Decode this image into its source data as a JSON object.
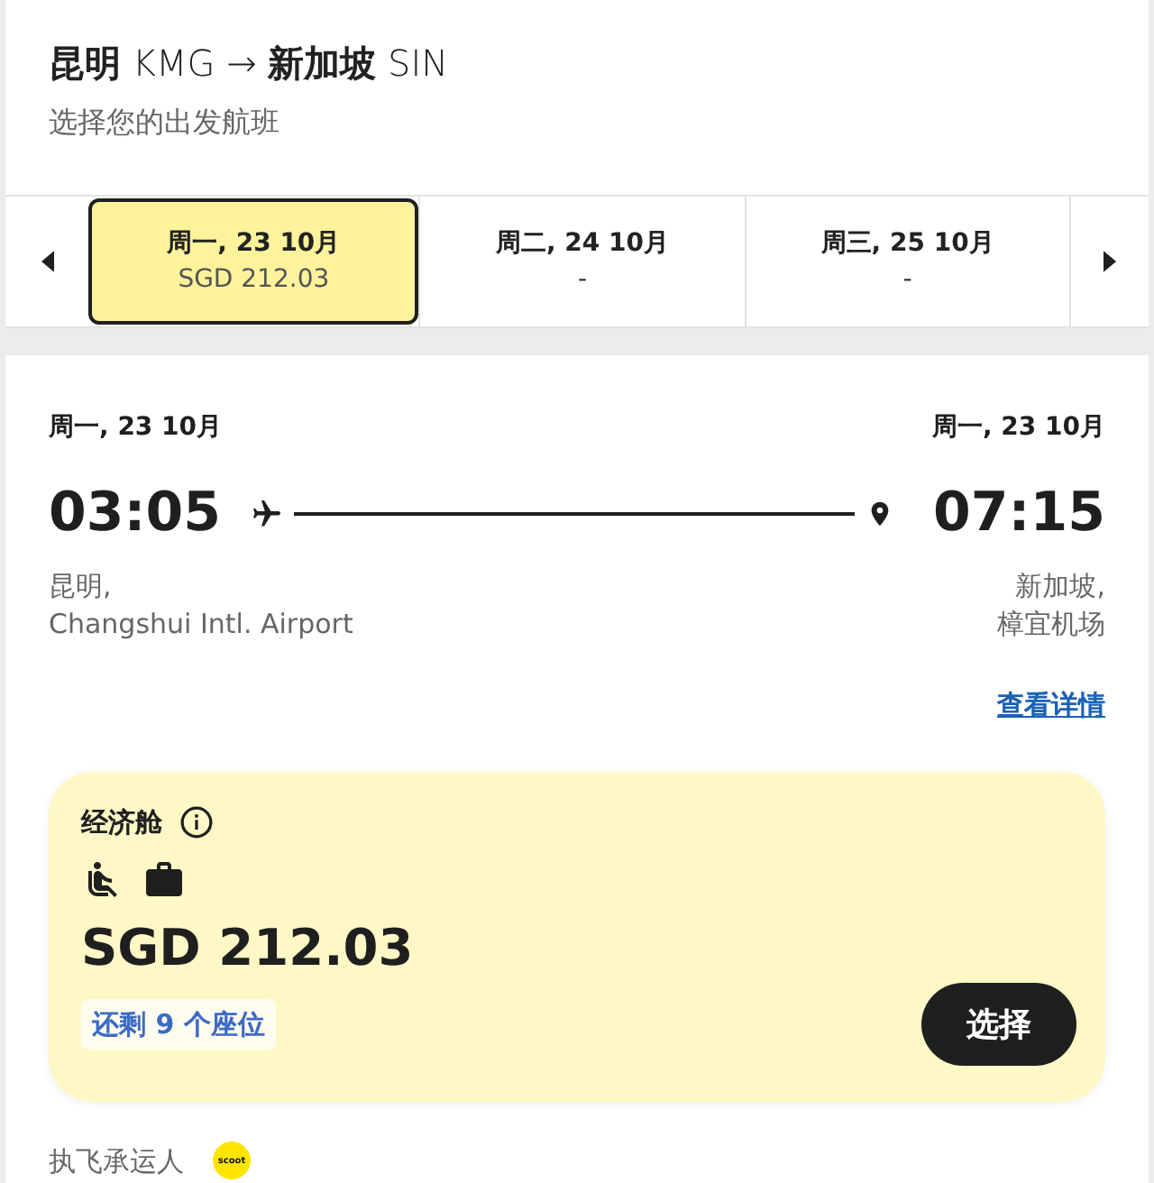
{
  "header": {
    "title": "**昆明** KMG → **新加坡** SIN",
    "subtitle": "选择您的出发航班"
  },
  "date_tabs": [
    {
      "day": "周一, 23 10月",
      "price": "SGD 212.03",
      "selected": true
    },
    {
      "day": "周二, 24 10月",
      "price": "-",
      "selected": false
    },
    {
      "day": "周三, 25 10月",
      "price": "-",
      "selected": false
    }
  ],
  "flight": {
    "departure": {
      "date": "周一, 23 10月",
      "time": "03:05",
      "city": "昆明,",
      "airport": "Changshui Intl. Airport"
    },
    "arrival": {
      "date": "周一, 23 10月",
      "time": "07:15",
      "city": "新加坡,",
      "airport": "樟宜机场"
    },
    "details_link": "查看详情"
  },
  "fare": {
    "cabin": "经济舱",
    "price": "SGD 212.03",
    "seats_left": "还剩 9 个座位",
    "select_button": "选择"
  },
  "carrier": {
    "label": "执飞承运人",
    "logo_text": "scoot"
  }
}
